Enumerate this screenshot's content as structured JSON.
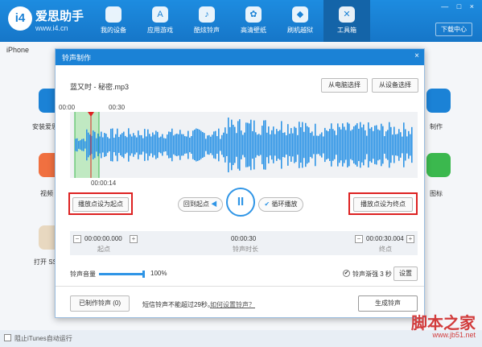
{
  "app": {
    "brand": "爱思助手",
    "url": "www.i4.cn",
    "logo_text": "i4",
    "window_controls": "— □ ×",
    "download_center": "下载中心"
  },
  "nav": [
    {
      "label": "我的设备",
      "icon": "apple-icon",
      "glyph": ""
    },
    {
      "label": "应用游戏",
      "icon": "appstore-icon",
      "glyph": "A"
    },
    {
      "label": "酷炫铃声",
      "icon": "bell-icon",
      "glyph": "♪"
    },
    {
      "label": "高清壁纸",
      "icon": "flower-icon",
      "glyph": "✿"
    },
    {
      "label": "刷机越狱",
      "icon": "box-icon",
      "glyph": "◆"
    },
    {
      "label": "工具箱",
      "icon": "tools-icon",
      "glyph": "✕"
    }
  ],
  "background": {
    "tab": "iPhone",
    "left_labels": [
      "安装爱思",
      "视频",
      "打开 SS"
    ],
    "right_labels": [
      "制作",
      "图标"
    ]
  },
  "footer": {
    "label": "阻止iTunes自动运行"
  },
  "watermark": {
    "text": "脚本之家",
    "url": "www.jb51.net"
  },
  "modal": {
    "title": "铃声制作",
    "close": "×",
    "filename": "蓝又时 - 秘密.mp3",
    "from_computer": "从电脑选择",
    "from_device": "从设备选择",
    "timeline": {
      "start": "00:00",
      "mark": "00:30",
      "cursor": "00:00:14"
    },
    "set_start": "播放点设为起点",
    "set_end": "播放点设为终点",
    "back_to_start": "回到起点",
    "loop_play": "循环播放",
    "play_symbol": "II",
    "start_time": "00:00:00.000",
    "start_label": "起点",
    "duration": "00:00:30",
    "duration_label": "铃声时长",
    "end_time": "00:00:30.004",
    "end_label": "终点",
    "volume_label": "铃声音量",
    "volume_pct": "100%",
    "volume_value": 1.0,
    "fade_label": "铃声渐强 3 秒",
    "settings": "设置",
    "made_ringtones": "已制作铃声 (0)",
    "note": "短信铃声不能超过29秒。",
    "how_to": "如何设置铃声？",
    "generate": "生成铃声"
  },
  "colors": {
    "accent": "#1b82d6",
    "wave": "#2f95e6",
    "selection": "#8fe08f",
    "highlight_box": "#dd2222"
  }
}
